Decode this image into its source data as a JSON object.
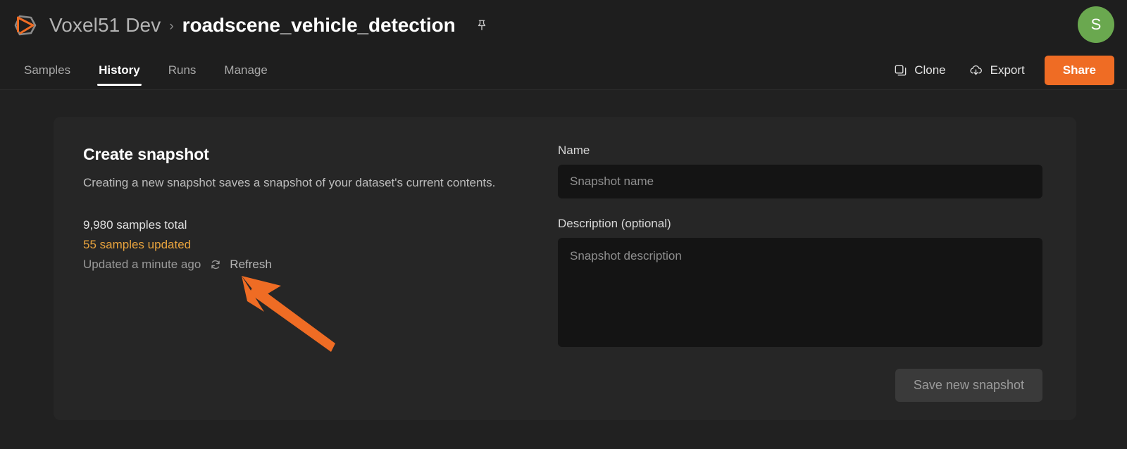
{
  "header": {
    "logo_icon": "voxel51-logo-icon",
    "org_name": "Voxel51 Dev",
    "breadcrumb_separator": "›",
    "dataset_name": "roadscene_vehicle_detection",
    "pin_icon": "pin-icon",
    "avatar_initial": "S",
    "avatar_color": "#6aa84f",
    "tabs": [
      {
        "label": "Samples",
        "active": false
      },
      {
        "label": "History",
        "active": true
      },
      {
        "label": "Runs",
        "active": false
      },
      {
        "label": "Manage",
        "active": false
      }
    ],
    "actions": {
      "clone_label": "Clone",
      "clone_icon": "copy-icon",
      "export_label": "Export",
      "export_icon": "cloud-download-icon",
      "share_label": "Share",
      "share_color": "#ef6c24"
    }
  },
  "card": {
    "title": "Create snapshot",
    "description": "Creating a new snapshot saves a snapshot of your dataset's current contents.",
    "stats": {
      "total": "9,980 samples total",
      "updated": "55 samples updated",
      "updated_color": "#e8a33d",
      "timestamp": "Updated a minute ago",
      "refresh_label": "Refresh",
      "refresh_icon": "refresh-icon"
    },
    "form": {
      "name_label": "Name",
      "name_value": "",
      "name_placeholder": "Snapshot name",
      "description_label": "Description (optional)",
      "description_value": "",
      "description_placeholder": "Snapshot description",
      "save_label": "Save new snapshot"
    }
  },
  "annotation": {
    "arrow_color": "#ef6c24",
    "arrow_tip": "343,392",
    "arrow_tail": "477,495"
  }
}
